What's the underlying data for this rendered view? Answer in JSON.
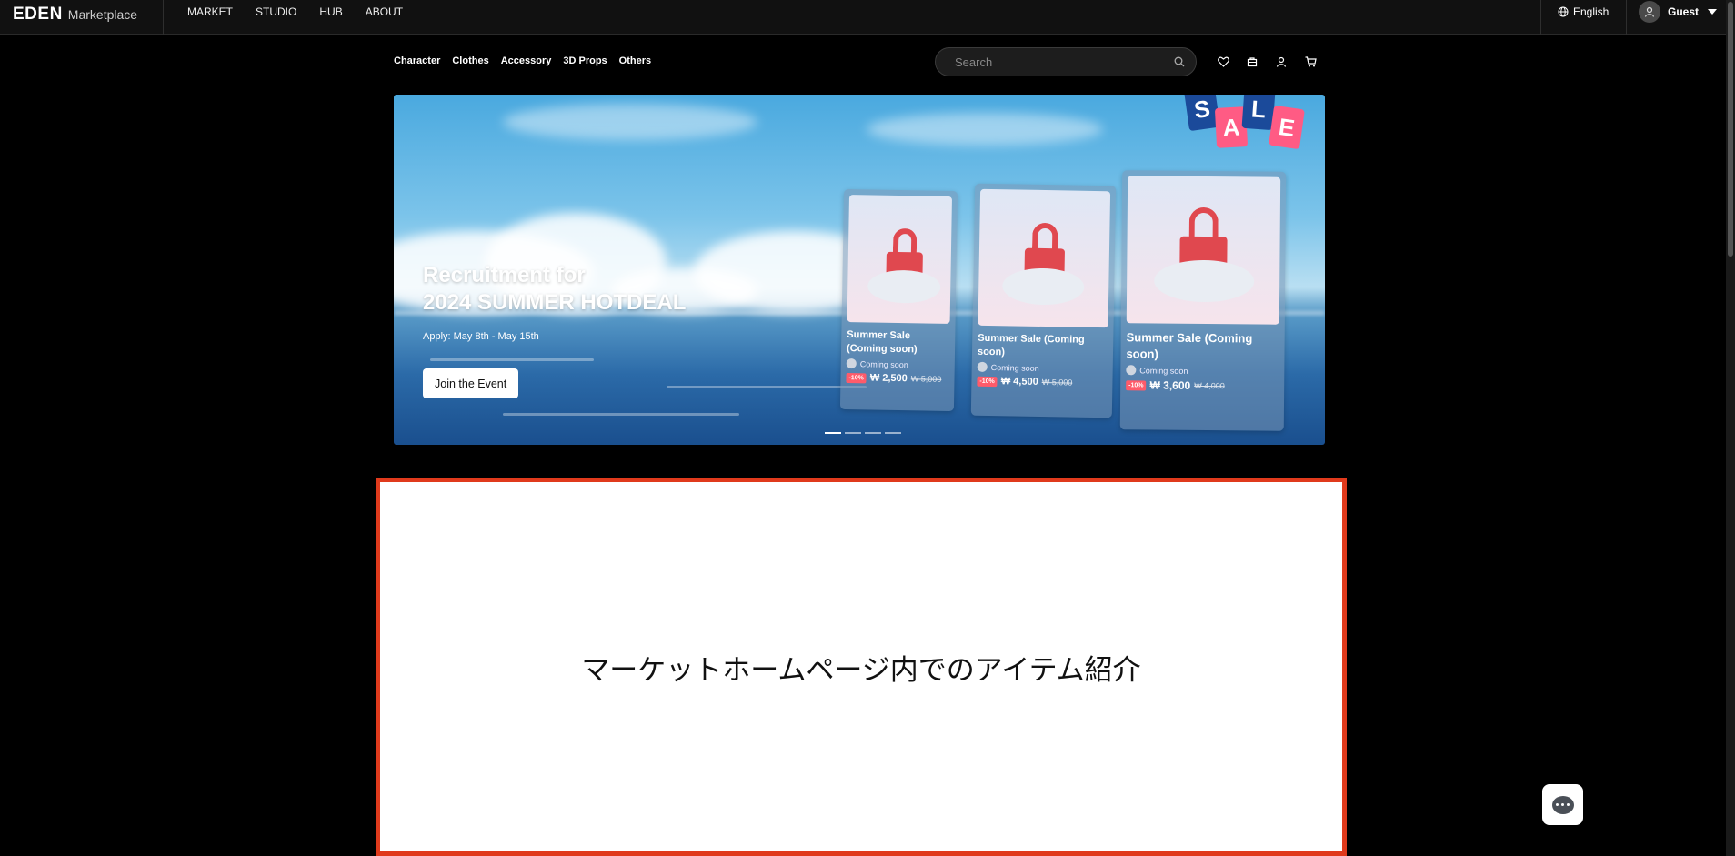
{
  "header": {
    "logo_main": "EDEN",
    "logo_sub": "Marketplace",
    "nav": [
      "MARKET",
      "STUDIO",
      "HUB",
      "ABOUT"
    ],
    "language": "English",
    "user": "Guest"
  },
  "subnav": {
    "categories": [
      "Character",
      "Clothes",
      "Accessory",
      "3D Props",
      "Others"
    ],
    "search_placeholder": "Search",
    "icons": [
      "heart-icon",
      "bag-icon",
      "user-icon",
      "cart-icon"
    ]
  },
  "banner": {
    "title_line1": "Recruitment for",
    "title_line2": "2024 SUMMER HOTDEAL",
    "date": "Apply: May 8th - May 15th",
    "cta": "Join the Event",
    "sale_letters": [
      "S",
      "A",
      "L",
      "E"
    ],
    "cards": [
      {
        "title": "Summer Sale (Coming soon)",
        "creator": "Coming soon",
        "discount": "-10%",
        "price": "₩ 2,500",
        "old_price": "₩ 5,000"
      },
      {
        "title": "Summer Sale (Coming soon)",
        "creator": "Coming soon",
        "discount": "-10%",
        "price": "₩ 4,500",
        "old_price": "₩ 5,000"
      },
      {
        "title": "Summer Sale (Coming soon)",
        "creator": "Coming soon",
        "discount": "-10%",
        "price": "₩ 3,600",
        "old_price": "₩ 4,000"
      }
    ],
    "slides_total": 4,
    "slide_active": 1
  },
  "intro": {
    "text": "マーケットホームページ内でのアイテム紹介"
  },
  "colors": {
    "accent_border": "#e03a1c",
    "discount": "#ff5b6a"
  }
}
